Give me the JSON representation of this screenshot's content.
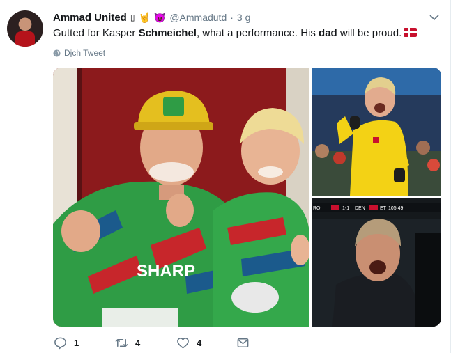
{
  "tweet": {
    "author_name": "Ammad United",
    "name_emoji_box": "▯",
    "name_emoji_horns": "🤘",
    "name_emoji_devil": "😈",
    "handle": "@Ammadutd",
    "separator": "·",
    "time": "3 g",
    "text_part1": "Gutted for Kasper ",
    "text_bold1": "Schmeichel",
    "text_part2": ", what a performance. His ",
    "text_bold2": "dad",
    "text_part3": " will be proud.",
    "flag_icon": "denmark-flag-icon",
    "translate_label": "Dịch Tweet"
  },
  "media": {
    "images": [
      {
        "icon": "photo-schmeichel-father-son"
      },
      {
        "icon": "photo-goalkeeper-yellow-kit"
      },
      {
        "icon": "photo-peter-schmeichel-stands"
      }
    ],
    "scoreboard": {
      "home": "RO",
      "score": "1-1",
      "away": "DEN",
      "extra": "ET",
      "clock": "105:49"
    },
    "jersey_sponsor": "SHARP"
  },
  "actions": {
    "reply_count": "1",
    "retweet_count": "4",
    "like_count": "4"
  },
  "colors": {
    "muted": "#657786",
    "text": "#14171a",
    "accent": "#1da1f2",
    "jersey_green": "#2fa84a",
    "cap_yellow": "#e8c21a",
    "keeper_yellow": "#f3d215"
  }
}
